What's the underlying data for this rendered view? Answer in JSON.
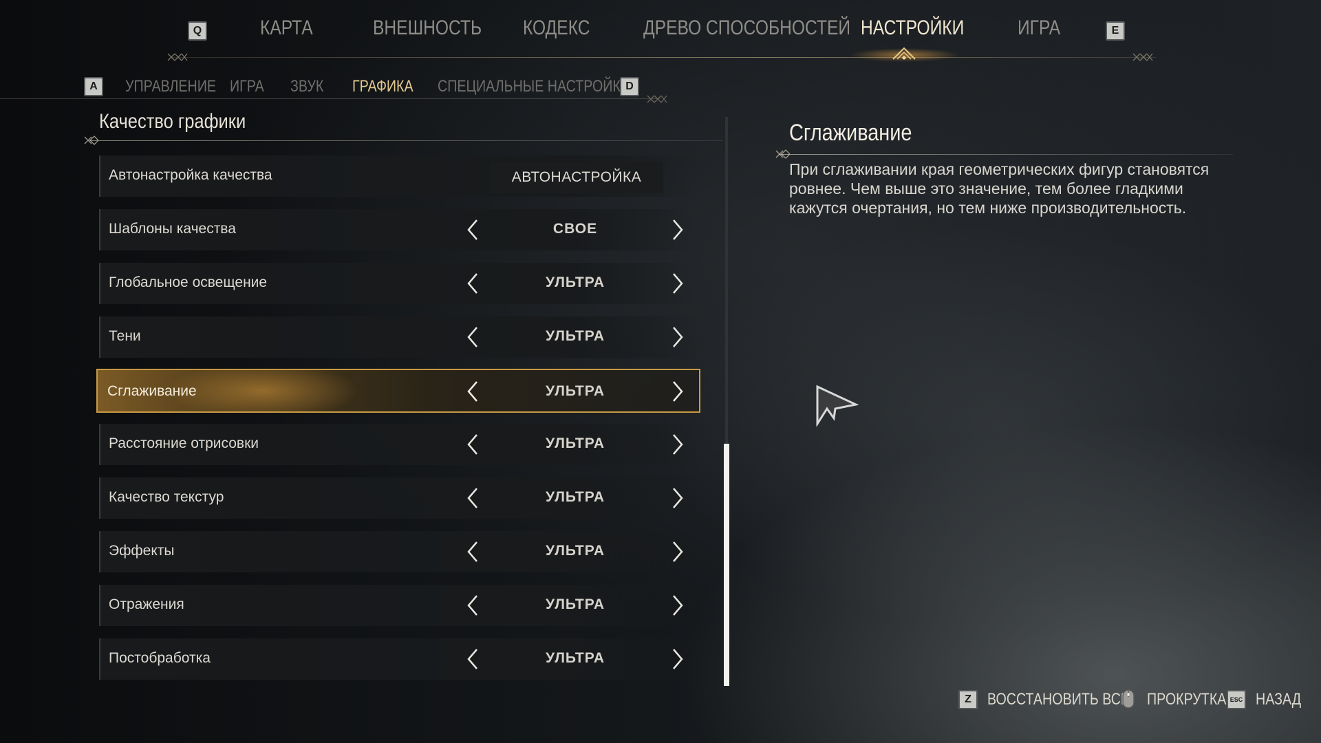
{
  "top_nav": {
    "prev_key": "Q",
    "next_key": "E",
    "items": [
      {
        "label": "КАРТА"
      },
      {
        "label": "ВНЕШНОСТЬ"
      },
      {
        "label": "КОДЕКС"
      },
      {
        "label": "ДРЕВО СПОСОБНОСТЕЙ"
      },
      {
        "label": "НАСТРОЙКИ",
        "active": true
      },
      {
        "label": "ИГРА"
      }
    ]
  },
  "sub_nav": {
    "prev_key": "A",
    "next_key": "D",
    "items": [
      {
        "label": "УПРАВЛЕНИЕ"
      },
      {
        "label": "ИГРА"
      },
      {
        "label": "ЗВУК"
      },
      {
        "label": "ГРАФИКА",
        "active": true
      },
      {
        "label": "СПЕЦИАЛЬНЫЕ НАСТРОЙКИ"
      }
    ]
  },
  "section": {
    "title": "Качество графики"
  },
  "settings": {
    "auto": {
      "label": "Автонастройка качества",
      "button": "АВТОНАСТРОЙКА"
    },
    "rows": [
      {
        "label": "Шаблоны качества",
        "value": "СВОЕ"
      },
      {
        "label": "Глобальное освещение",
        "value": "УЛЬТРА"
      },
      {
        "label": "Тени",
        "value": "УЛЬТРА"
      },
      {
        "label": "Сглаживание",
        "value": "УЛЬТРА",
        "selected": true
      },
      {
        "label": "Расстояние отрисовки",
        "value": "УЛЬТРА"
      },
      {
        "label": "Качество текстур",
        "value": "УЛЬТРА"
      },
      {
        "label": "Эффекты",
        "value": "УЛЬТРА"
      },
      {
        "label": "Отражения",
        "value": "УЛЬТРА"
      },
      {
        "label": "Постобработка",
        "value": "УЛЬТРА"
      }
    ]
  },
  "scrollbar": {
    "position_fraction": 0.57,
    "visible_fraction": 0.43
  },
  "description": {
    "title": "Сглаживание",
    "text": "При сглаживании края геометрических фигур становятся ровнее. Чем выше это значение, тем более гладкими кажутся очертания, но тем ниже производительность."
  },
  "footer": {
    "reset_key": "Z",
    "reset_label": "ВОССТАНОВИТЬ ВСЕ",
    "scroll_icon": "mouse-icon",
    "scroll_label": "ПРОКРУТКА",
    "back_key": "ESC",
    "back_label": "НАЗАД"
  },
  "colors": {
    "accent_gold": "#c89a45",
    "active_tab": "#e2c98f",
    "cursor": "#d8d8d8"
  }
}
